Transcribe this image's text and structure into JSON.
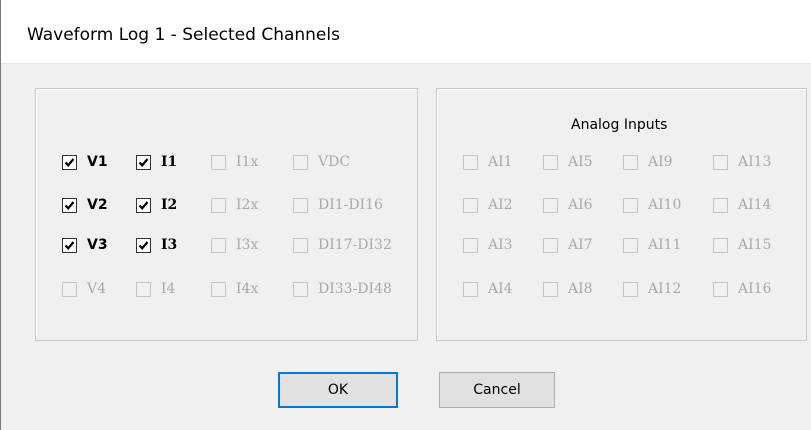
{
  "window": {
    "title": "Waveform Log 1 - Selected Channels"
  },
  "left_group": {
    "rows": [
      [
        {
          "label": "V1",
          "checked": true,
          "enabled": true
        },
        {
          "label": "I1",
          "checked": true,
          "enabled": true
        },
        {
          "label": "I1x",
          "checked": false,
          "enabled": false
        },
        {
          "label": "VDC",
          "checked": false,
          "enabled": false
        }
      ],
      [
        {
          "label": "V2",
          "checked": true,
          "enabled": true
        },
        {
          "label": "I2",
          "checked": true,
          "enabled": true
        },
        {
          "label": "I2x",
          "checked": false,
          "enabled": false
        },
        {
          "label": "DI1-DI16",
          "checked": false,
          "enabled": false
        }
      ],
      [
        {
          "label": "V3",
          "checked": true,
          "enabled": true
        },
        {
          "label": "I3",
          "checked": true,
          "enabled": true
        },
        {
          "label": "I3x",
          "checked": false,
          "enabled": false
        },
        {
          "label": "DI17-DI32",
          "checked": false,
          "enabled": false
        }
      ],
      [
        {
          "label": "V4",
          "checked": false,
          "enabled": false
        },
        {
          "label": "I4",
          "checked": false,
          "enabled": false
        },
        {
          "label": "I4x",
          "checked": false,
          "enabled": false
        },
        {
          "label": "DI33-DI48",
          "checked": false,
          "enabled": false
        }
      ]
    ]
  },
  "right_group": {
    "caption": "Analog Inputs",
    "rows": [
      [
        {
          "label": "AI1",
          "checked": false,
          "enabled": false
        },
        {
          "label": "AI5",
          "checked": false,
          "enabled": false
        },
        {
          "label": "AI9",
          "checked": false,
          "enabled": false
        },
        {
          "label": "AI13",
          "checked": false,
          "enabled": false
        }
      ],
      [
        {
          "label": "AI2",
          "checked": false,
          "enabled": false
        },
        {
          "label": "AI6",
          "checked": false,
          "enabled": false
        },
        {
          "label": "AI10",
          "checked": false,
          "enabled": false
        },
        {
          "label": "AI14",
          "checked": false,
          "enabled": false
        }
      ],
      [
        {
          "label": "AI3",
          "checked": false,
          "enabled": false
        },
        {
          "label": "AI7",
          "checked": false,
          "enabled": false
        },
        {
          "label": "AI11",
          "checked": false,
          "enabled": false
        },
        {
          "label": "AI15",
          "checked": false,
          "enabled": false
        }
      ],
      [
        {
          "label": "AI4",
          "checked": false,
          "enabled": false
        },
        {
          "label": "AI8",
          "checked": false,
          "enabled": false
        },
        {
          "label": "AI12",
          "checked": false,
          "enabled": false
        },
        {
          "label": "AI16",
          "checked": false,
          "enabled": false
        }
      ]
    ]
  },
  "buttons": {
    "ok": "OK",
    "cancel": "Cancel"
  },
  "colors": {
    "default_button_border": "#0078d7",
    "disabled_text": "#a9a9a9"
  }
}
